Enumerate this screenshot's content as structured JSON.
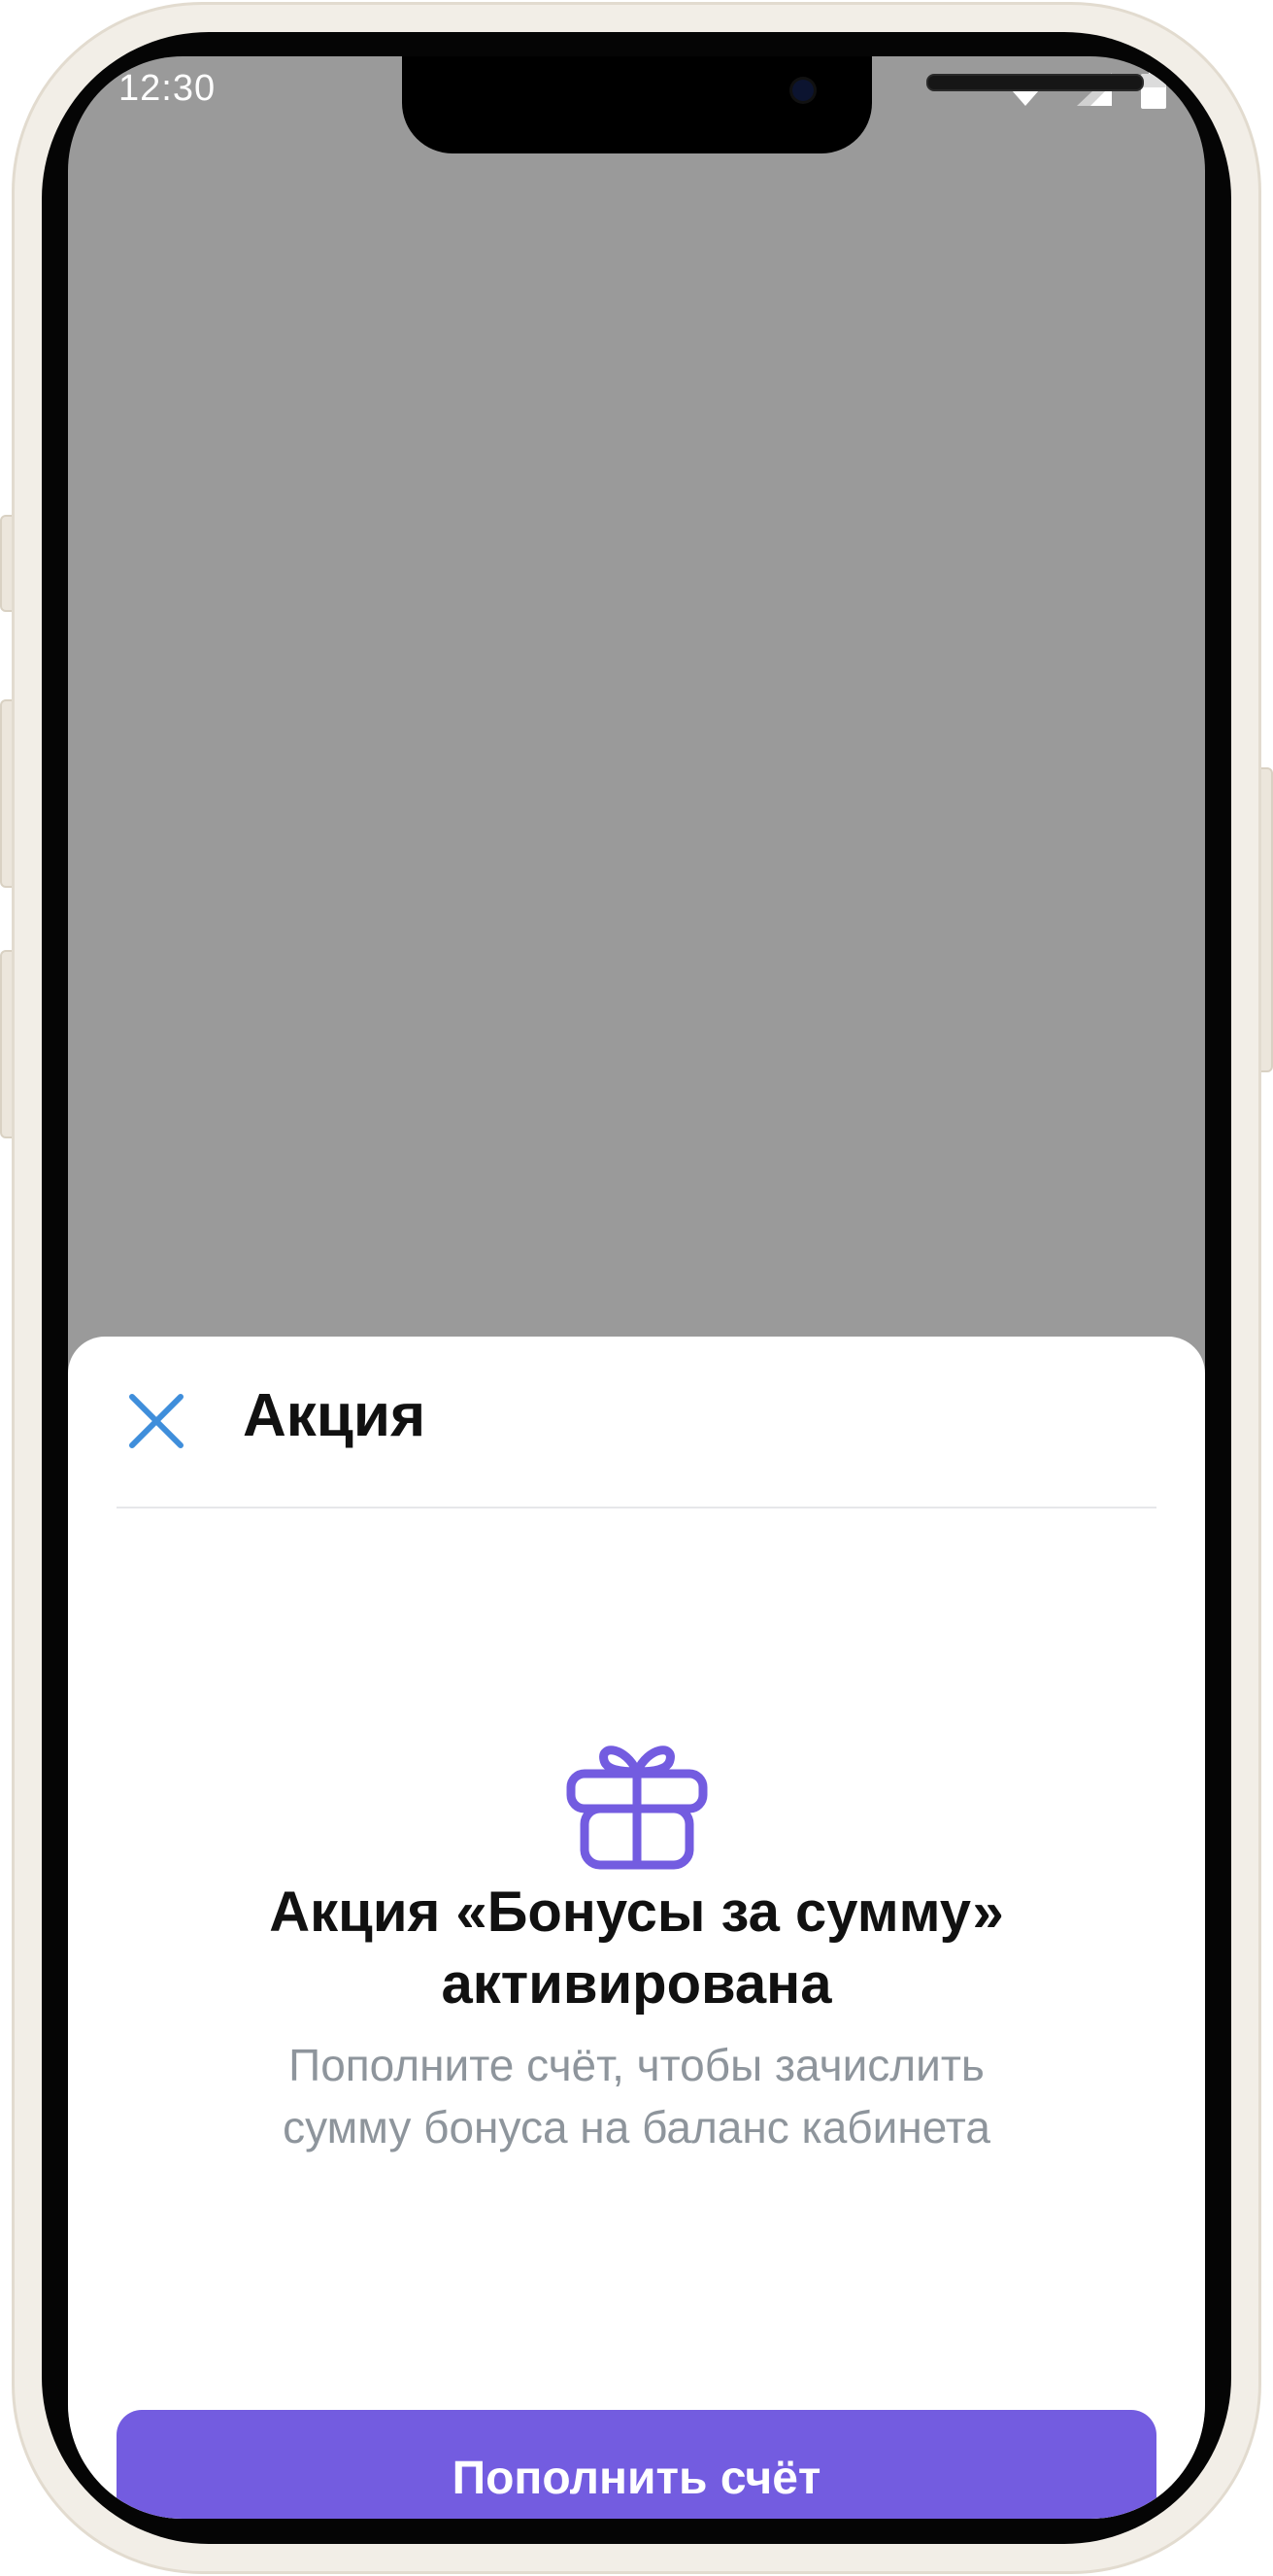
{
  "status_bar": {
    "time": "12:30",
    "icons": [
      "wifi-icon",
      "cellular-signal-icon",
      "battery-icon"
    ]
  },
  "sheet": {
    "title": "Акция",
    "close_icon": "close-icon",
    "promo_icon": "gift-icon",
    "headline_line1": "Акция «Бонусы за сумму»",
    "headline_line2": "активирована",
    "subtext_line1": "Пополните счёт, чтобы зачислить",
    "subtext_line2": "сумму бонуса на баланс кабинета",
    "primary_button_label": "Пополнить счёт"
  },
  "colors": {
    "accent": "#735ce0",
    "close_icon": "#3f8edb",
    "overlay": "#9a9a9a",
    "subtext": "#8e959c"
  }
}
